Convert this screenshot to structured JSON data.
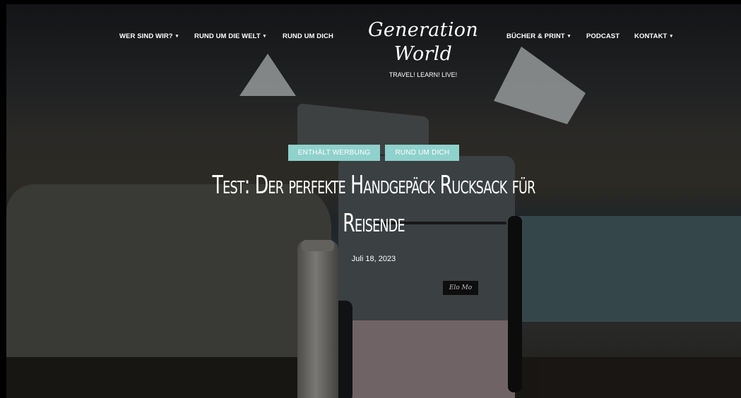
{
  "site": {
    "logo_text": "Generation World",
    "tagline": "TRAVEL! LEARN! LIVE!"
  },
  "nav": {
    "items": [
      {
        "label": "WER SIND WIR?",
        "dropdown": true
      },
      {
        "label": "RUND UM DIE WELT",
        "dropdown": true
      },
      {
        "label": "RUND UM DICH",
        "dropdown": false
      },
      {
        "label": "BÜCHER & PRINT",
        "dropdown": true
      },
      {
        "label": "PODCAST",
        "dropdown": false
      },
      {
        "label": "KONTAKT",
        "dropdown": true
      }
    ],
    "caret": "▾"
  },
  "post": {
    "tags": [
      "ENTHÄLT WERBUNG",
      "RUND UM DICH"
    ],
    "title": "Test: Der perfekte Handgepäck Rucksack für Reisende",
    "date": "Juli 18, 2023",
    "bag_label": "Elo Mo"
  },
  "colors": {
    "tag_bg": "#8fd1cc",
    "text": "#ffffff"
  }
}
